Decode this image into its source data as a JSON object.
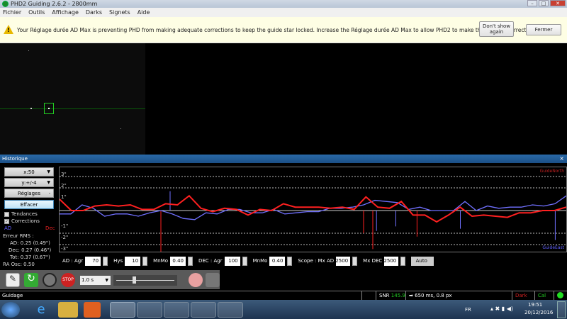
{
  "window": {
    "title": "PHD2 Guiding 2.6.2 - 2800mm"
  },
  "menu": [
    "Fichier",
    "Outils",
    "Affichage",
    "Darks",
    "Signets",
    "Aide"
  ],
  "notification": {
    "message": "Your Réglage durée AD Max is preventing PHD from making adequate corrections to keep the guide star locked. Increase the Réglage durée AD Max to allow PHD2 to make the needed corrections.",
    "dont_show": "Don't show again",
    "close": "Fermer"
  },
  "history": {
    "title": "Historique",
    "scale": "x:50",
    "yscale": "y:+/-4",
    "settings": "Réglages",
    "clear": "Effacer",
    "trends": "Tendances",
    "corrections": "Corrections",
    "ra_label": "AD",
    "dec_label": "Dec",
    "rms_title": "Erreur RMS :",
    "rms_ra": "AD: 0.25 (0.49\")",
    "rms_dec": "Dec: 0.27 (0.46\")",
    "rms_tot": "Tot: 0.37 (0.67\")",
    "ra_osc": "RA Osc: 0.50",
    "north_label": "GuideNorth",
    "east_label": "GuideEast"
  },
  "chart_data": {
    "type": "line",
    "y_ticks": [
      "3\"",
      "2\"",
      "1\"",
      "-1\"",
      "-2\"",
      "-3\""
    ],
    "ylim": [
      -3.5,
      3.5
    ],
    "series": [
      {
        "name": "AD",
        "color": "#7070ff",
        "values": [
          -0.3,
          -0.3,
          0.5,
          0.2,
          -0.5,
          -0.3,
          -0.3,
          -0.5,
          -0.2,
          0,
          -0.3,
          -0.7,
          -0.8,
          -0.2,
          -0.3,
          0.1,
          0.1,
          -0.2,
          -0.2,
          0.1,
          -0.3,
          -0.2,
          -0.1,
          -0.1,
          0.2,
          0.2,
          0.3,
          0.5,
          0.9,
          0.8,
          0.7,
          0.1,
          0.3,
          0,
          0,
          0,
          0.8,
          0,
          0.4,
          0.2,
          0.3,
          0.3,
          0.5,
          0.4,
          0.6,
          1.3
        ]
      },
      {
        "name": "Dec",
        "color": "#ff2020",
        "values": [
          1,
          0,
          0,
          0.4,
          0.5,
          0.4,
          0.5,
          0.1,
          0.1,
          0.6,
          0.5,
          1.3,
          0.2,
          -0.1,
          0.2,
          0.1,
          -0.4,
          0.1,
          0,
          0.6,
          0.3,
          0.3,
          0.3,
          0.2,
          0.3,
          0.1,
          1.2,
          0.3,
          0.2,
          0.8,
          -0.4,
          -0.4,
          -1.0,
          -0.4,
          0.3,
          -0.5,
          -0.4,
          -0.5,
          -0.6,
          -0.2,
          -0.2,
          0,
          0,
          0.3
        ]
      }
    ],
    "corrections": [
      {
        "i": 11,
        "v": -3.8,
        "c": "#ff2020"
      },
      {
        "i": 12,
        "v": 1.7,
        "c": "#7070ff"
      },
      {
        "i": 33,
        "v": -2,
        "c": "#ff2020"
      },
      {
        "i": 34,
        "v": -3.4,
        "c": "#ff2020"
      },
      {
        "i": 34.4,
        "v": -1.8,
        "c": "#7070ff"
      },
      {
        "i": 36.5,
        "v": -1.4,
        "c": "#7070ff"
      },
      {
        "i": 38.8,
        "v": -2.3,
        "c": "#ff2020"
      },
      {
        "i": 43.5,
        "v": -1.6,
        "c": "#7070ff"
      },
      {
        "i": 53.8,
        "v": -2.6,
        "c": "#7070ff"
      }
    ]
  },
  "controls": {
    "ra_agr_label": "AD : Agr",
    "ra_agr": "70",
    "hys_label": "Hys",
    "hys": "10",
    "mnmo_label": "MnMo",
    "mnmo": "0.40",
    "dec_agr_label": "DEC : Agr",
    "dec_agr": "100",
    "dec_mnmo_label": "MnMo",
    "dec_mnmo": "0.40",
    "scope_label": "Scope : Mx AD",
    "mx_ad": "2500",
    "mx_dec_label": "Mx DEC",
    "mx_dec": "2500",
    "mode": "Auto"
  },
  "toolbar": {
    "exposure": "1.0 s",
    "gamma": 0.3
  },
  "status": {
    "text": "Guidage",
    "snr_label": "SNR",
    "snr": "145.9",
    "guide": "650 ms, 0.8 px",
    "dark": "Dark",
    "cal": "Cal"
  },
  "taskbar": {
    "lang": "FR",
    "time": "19:51",
    "date": "20/12/2016"
  }
}
